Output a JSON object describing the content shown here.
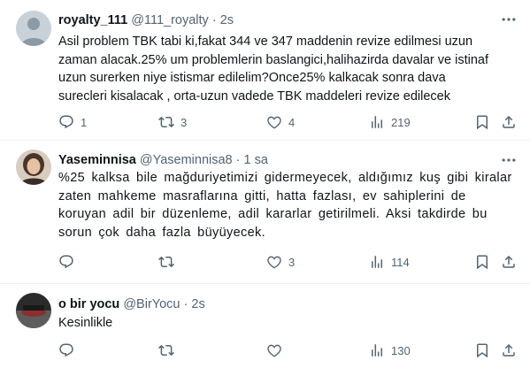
{
  "tweets": [
    {
      "name": "royalty_111",
      "handle": "@111_royalty",
      "time": "2s",
      "lines": [
        "Asil problem TBK tabi ki,fakat 344 ve 347 maddenin revize edilmesi uzun",
        "zaman alacak.25% um problemlerin baslangici,halihazirda davalar ve istinaf",
        "uzun surerken niye istismar edilelim?Once25% kalkacak sonra dava",
        "surecleri kisalacak , orta-uzun vadede TBK maddeleri revize edilecek"
      ],
      "replies": "1",
      "retweets": "3",
      "likes": "4",
      "views": "219"
    },
    {
      "name": "Yaseminnisa",
      "handle": "@Yaseminnisa8",
      "time": "1 sa",
      "lines": [
        "%25 kalksa bile mağduriyetimizi gidermeyecek, aldığımız kuş gibi kiralar",
        "zaten mahkeme masraflarına gitti, hatta fazlası, ev sahiplerini de",
        "koruyan adil bir düzenleme, adil kararlar getirilmeli. Aksi takdirde bu",
        "sorun çok daha fazla büyüyecek."
      ],
      "replies": "",
      "retweets": "",
      "likes": "3",
      "views": "114"
    },
    {
      "name": "o bir yocu",
      "handle": "@BirYocu",
      "time": "2s",
      "lines": [
        "Kesinlikle"
      ],
      "replies": "",
      "retweets": "",
      "likes": "",
      "views": "130"
    }
  ],
  "separator": "·",
  "colors": {
    "text": "#0f1419",
    "muted": "#536471",
    "divider": "#eff3f4"
  },
  "icons": [
    "more-icon",
    "reply-icon",
    "retweet-icon",
    "like-icon",
    "views-icon",
    "bookmark-icon",
    "share-icon"
  ]
}
